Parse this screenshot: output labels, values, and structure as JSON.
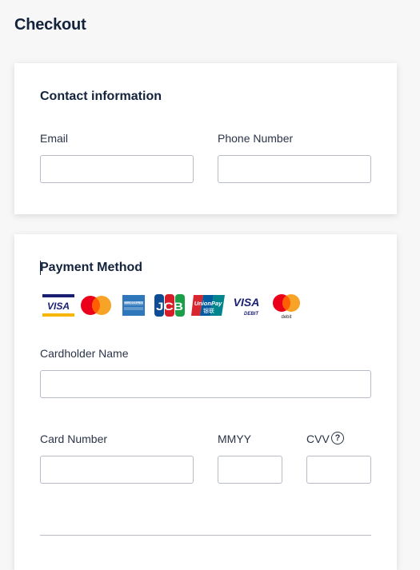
{
  "page": {
    "title": "Checkout"
  },
  "contact": {
    "title": "Contact information",
    "email_label": "Email",
    "email_value": "",
    "phone_label": "Phone Number",
    "phone_value": ""
  },
  "payment": {
    "title": "Payment Method",
    "logos": [
      "visa-logo",
      "mastercard-logo",
      "amex-logo",
      "jcb-logo",
      "unionpay-logo",
      "visa-debit-logo",
      "mastercard-debit-logo"
    ],
    "visa_text": "VISA",
    "amex_text": "AMERICAN EXPRESS",
    "jcb_text": "JCB",
    "unionpay_text": "UnionPay",
    "unionpay_sub": "银联",
    "visa_debit_text": "VISA",
    "visa_debit_sub": "DEBIT",
    "mc_debit_sub": "debit",
    "cardholder_label": "Cardholder Name",
    "cardholder_value": "",
    "card_number_label": "Card Number",
    "card_number_value": "",
    "expiry_label": "MMYY",
    "expiry_value": "",
    "cvv_label": "CVV",
    "cvv_value": "",
    "help_symbol": "?"
  },
  "colors": {
    "visa_blue": "#1a1f71",
    "visa_gold": "#f7b600",
    "mc_red": "#eb001b",
    "mc_orange": "#f79e1b",
    "amex_blue": "#2e77bb",
    "jcb_blue": "#0e4c96",
    "jcb_red": "#d71e28",
    "jcb_green": "#1a9e48",
    "unionpay_red": "#d7262f",
    "unionpay_blue": "#005b9f",
    "unionpay_teal": "#00848e"
  }
}
